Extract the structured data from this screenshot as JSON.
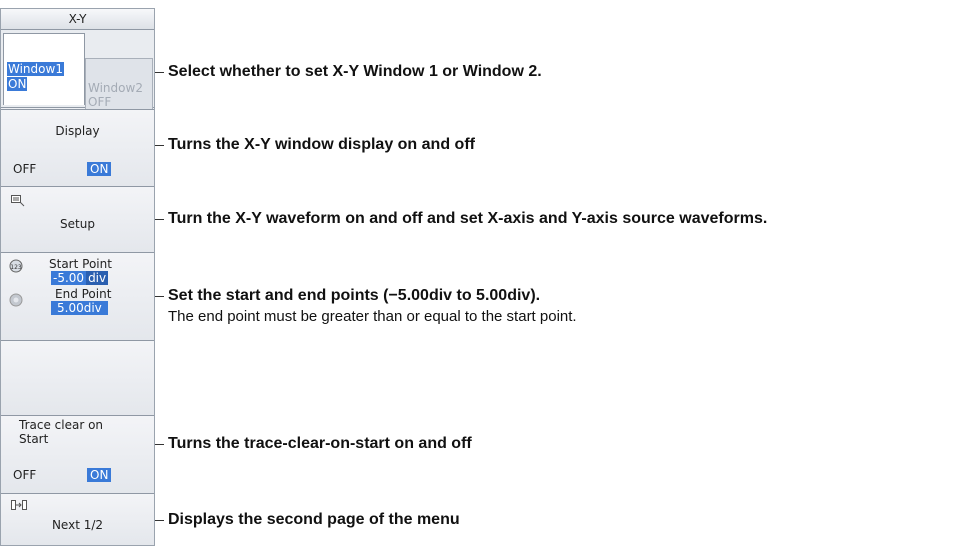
{
  "menu": {
    "title": "X-Y",
    "window_tabs": {
      "tab1_name": "Window1",
      "tab1_state": "ON",
      "tab2_name": "Window2",
      "tab2_state": "OFF"
    },
    "display": {
      "label": "Display",
      "off": "OFF",
      "on": "ON"
    },
    "setup": {
      "icon": "setup-icon",
      "label": "Setup"
    },
    "points": {
      "start_label": "Start Point",
      "start_value_a": "-5.00",
      "start_value_b": "div",
      "end_label": "End Point",
      "end_value": "5.00div"
    },
    "trace_clear": {
      "label_line1": "Trace clear on",
      "label_line2": "Start",
      "off": "OFF",
      "on": "ON"
    },
    "next": {
      "icon": "next-page-icon",
      "label": "Next 1/2"
    }
  },
  "annotations": {
    "window": "Select whether to set X-Y Window 1 or Window 2.",
    "display": "Turns the X-Y window display on and off",
    "setup": "Turn the X-Y waveform on and off and set X-axis and Y-axis source waveforms.",
    "points": "Set the start and end points (−5.00div to 5.00div).",
    "points_sub": "The end point must be greater than or equal to the start point.",
    "trace": "Turns the trace-clear-on-start on and off",
    "next": "Displays the second page of the menu"
  },
  "colors": {
    "highlight": "#3a7ad8",
    "inactive": "#aab1bb"
  }
}
